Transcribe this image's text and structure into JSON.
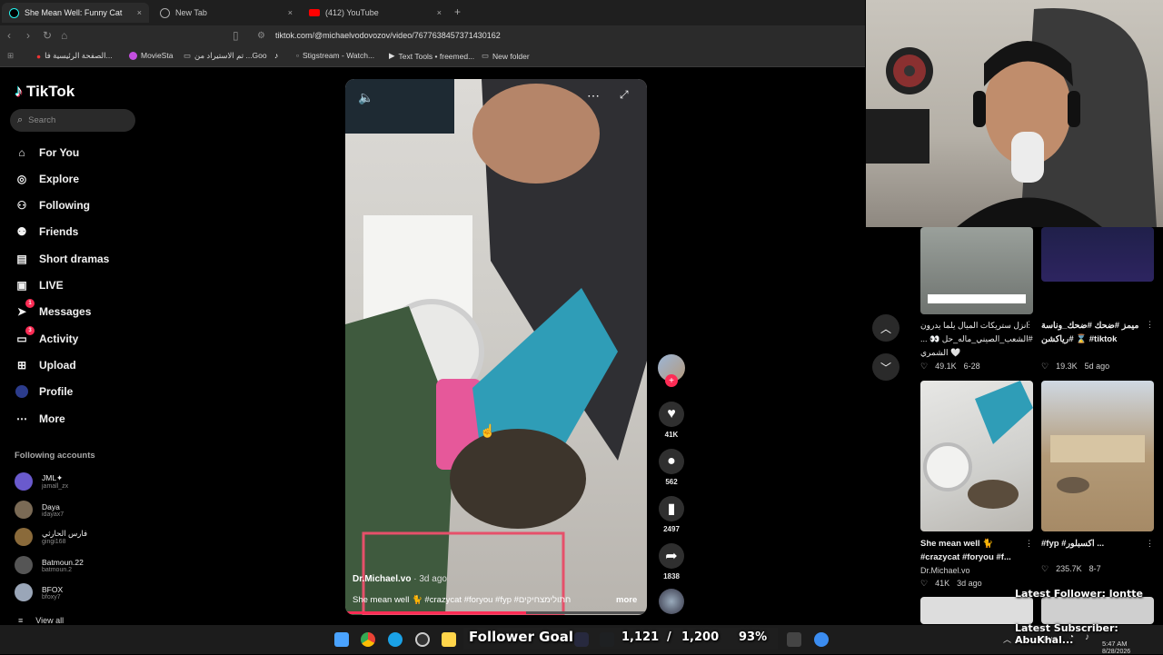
{
  "browser": {
    "tabs": [
      {
        "title": "She Mean Well: Funny Cat M",
        "close": "×"
      },
      {
        "title": "New Tab",
        "close": "×"
      },
      {
        "title": "(412) YouTube",
        "close": "×"
      }
    ],
    "new_tab": "+",
    "url": "tiktok.com/@michaelvodovozov/video/7677638457371430162",
    "bookmarks": [
      "الصفحة الرئيسية فا...",
      "MovieSta",
      "تم الاستيراد من ...Goo",
      "",
      "Stigstream - Watch...",
      "Text Tools • freemed...",
      "New folder"
    ]
  },
  "sidebar": {
    "logo": "TikTok",
    "search_placeholder": "Search",
    "nav": [
      "For You",
      "Explore",
      "Following",
      "Friends",
      "Short dramas",
      "LIVE",
      "Messages",
      "Activity",
      "Upload",
      "Profile",
      "More"
    ],
    "messages_badge": "1",
    "activity_badge": "3",
    "following_title": "Following accounts",
    "accounts": [
      {
        "name": "JML✦",
        "handle": "jamall_zx"
      },
      {
        "name": "Daya",
        "handle": "idayax7"
      },
      {
        "name": "فارس الحارثي",
        "handle": "gingi168"
      },
      {
        "name": "Batmoun.22",
        "handle": "batmoun.2"
      },
      {
        "name": "BFOX",
        "handle": "bfoxy7"
      }
    ],
    "view_all": "View all"
  },
  "video": {
    "author": "Dr.Michael.vo",
    "age": "· 3d ago",
    "caption": "She mean well 🐈 #crazycat #foryou #fyp #חתולימצחיקים",
    "more": "more",
    "likes": "41K",
    "comments": "562",
    "saves": "2497",
    "shares": "1838"
  },
  "grid": [
    {
      "caption": "انزل ستريكات الميال يلما يدرون #الشعب_الصيني_ماله_حل 👀 ... الشمري 🤍",
      "likes": "49.1K",
      "date": "6-28"
    },
    {
      "caption": "ميمز #ضحك #ضحك_وناسة #رياكشن ⌛ #tiktok",
      "likes": "19.3K",
      "date": "5d ago"
    },
    {
      "caption": "She mean well 🐈 #crazycat #foryou #f...",
      "author": "Dr.Michael.vo",
      "likes": "41K",
      "date": "3d ago"
    },
    {
      "caption": "#fyp #اكسبلور ...",
      "likes": "235.7K",
      "date": "8-7"
    }
  ],
  "stream": {
    "latest_follower": "Latest Follower: lontte",
    "latest_subscriber": "Latest Subscriber: AbuKhal...",
    "goal_label": "Follower Goal",
    "goal_current": "1,121",
    "goal_sep": "/",
    "goal_target": "1,200",
    "goal_percent": "93%"
  },
  "taskbar": {
    "lang": "ENG",
    "time": "5:47 AM",
    "date": "8/28/2026"
  },
  "colors": {
    "accent": "#fe2c55",
    "tiktok_cyan": "#25f4ee"
  }
}
